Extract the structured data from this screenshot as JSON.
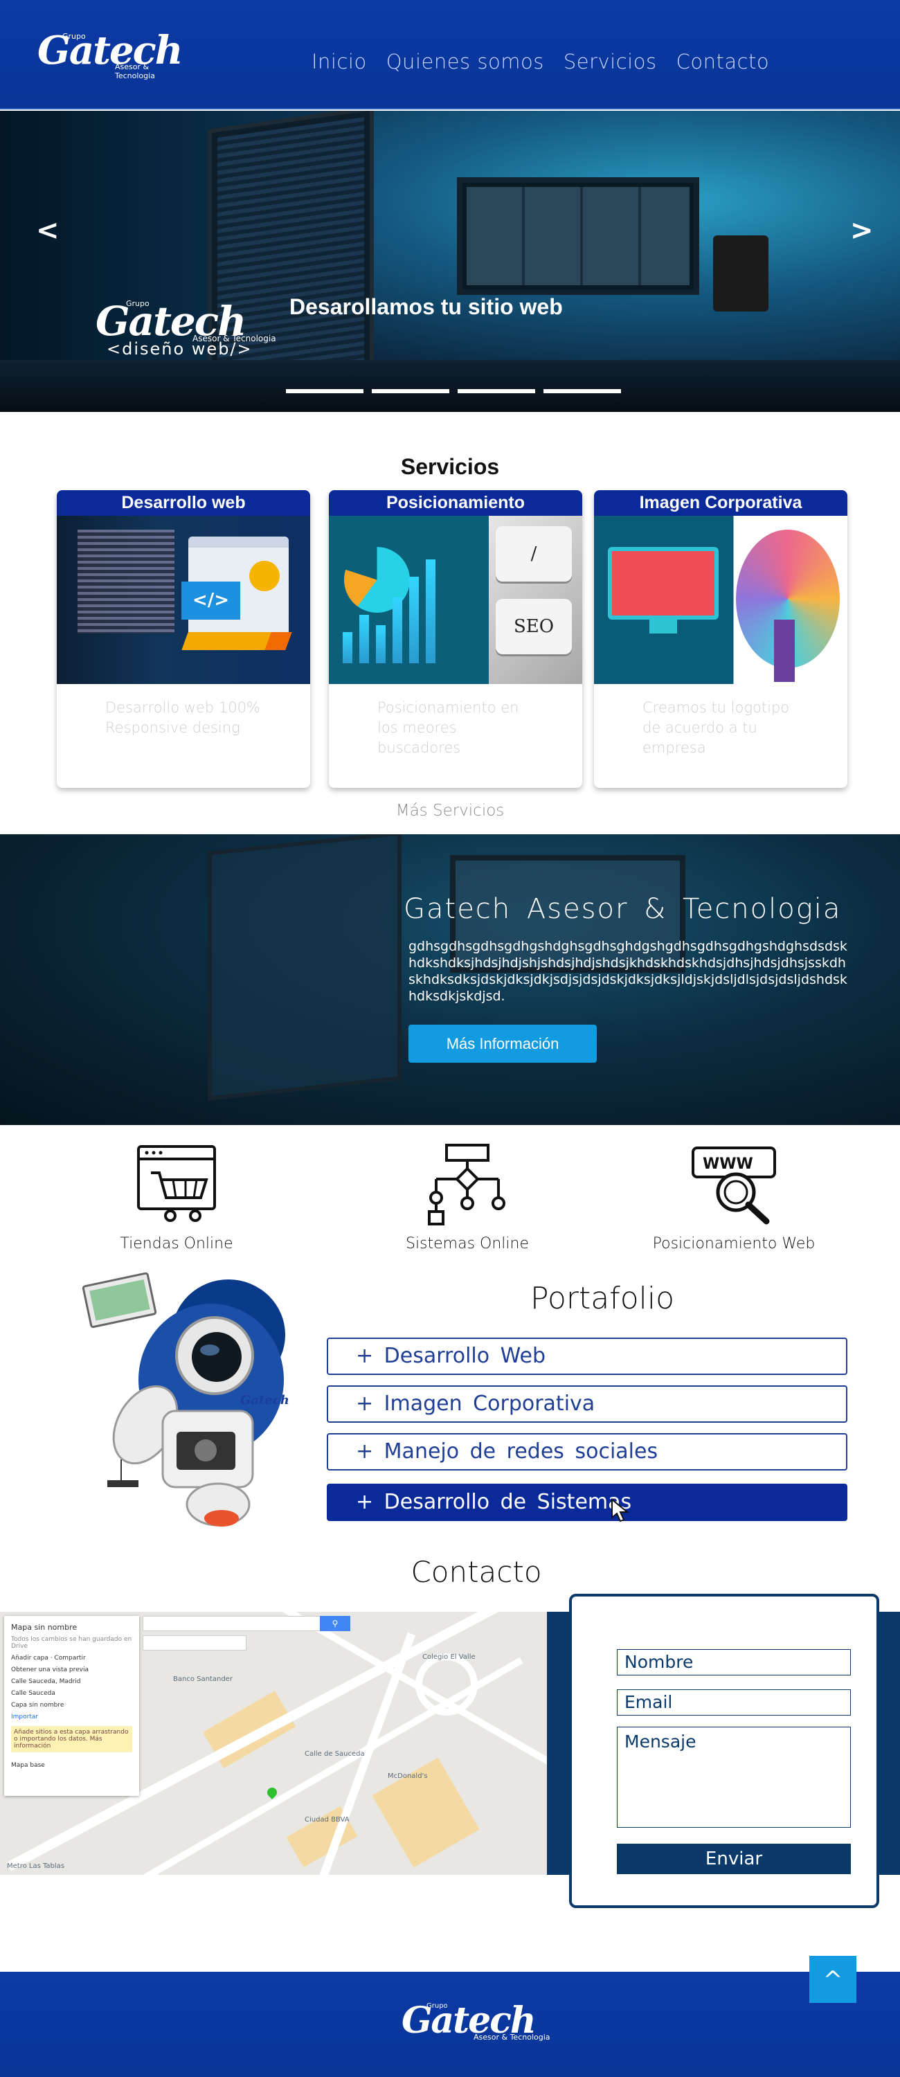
{
  "header": {
    "logo": {
      "small": "Grupo",
      "name": "Gatech",
      "sub": "Asesor & Tecnologia"
    },
    "nav": [
      "Inicio",
      "Quienes somos",
      "Servicios",
      "Contacto"
    ]
  },
  "hero": {
    "prev": "<",
    "next": ">",
    "logo": {
      "small": "Grupo",
      "name": "Gatech",
      "sub": "Asesor & Tecnologia"
    },
    "tagline": "<diseño web/>",
    "headline": "Desarollamos tu sitio web"
  },
  "servicios": {
    "title": "Servicios",
    "cards": [
      {
        "title": "Desarrollo web",
        "text": "Desarrollo web 100% Responsive desing"
      },
      {
        "title": "Posicionamiento",
        "text": "Posicionamiento en los meores buscadores",
        "seo_label": "SEO"
      },
      {
        "title": "Imagen Corporativa",
        "text": "Creamos tu logotipo de acuerdo a tu empresa"
      }
    ],
    "more": "Más Servicios"
  },
  "banner": {
    "title": "Gatech Asesor & Tecnologia",
    "text": "gdhsgdhsgdhsgdhgshdghsgdhsghdgshgdhsgdhsgdhgshdghsdsdskhdkshdksjhdsjhdjshjshdsjhdjshdsjkhdskhdskhdsjdhsjhdsjdhsjsskdhskhdksdksjdskjdksjdkjsdjsjdsjdskjdksjdksjldjskjdsljdlsjdsjdsljdshdskhdksdkjskdjsd.",
    "button": "Más Información"
  },
  "features": [
    "Tiendas Online",
    "Sistemas Online",
    "Posicionamiento Web"
  ],
  "portafolio": {
    "title": "Portafolio",
    "items": [
      "+ Desarrollo Web",
      "+ Imagen Corporativa",
      "+ Manejo de redes sociales",
      "+ Desarrollo de Sistemas"
    ],
    "active_index": 3
  },
  "contacto": {
    "title": "Contacto",
    "map": {
      "panel_title": "Mapa sin nombre",
      "panel_sub": "Todos los cambios se han guardado en Drive",
      "rows": [
        "Añadir capa · Compartir",
        "Obtener una vista previa",
        "Calle Sauceda, Madrid",
        "Calle Sauceda",
        "Capa sin nombre",
        "Importar"
      ],
      "note": "Añade sitios a esta capa arrastrando o importando los datos. Más información",
      "base": "Mapa base",
      "labels": [
        "Banco Santander",
        "Colegio El Valle",
        "Ciudad BBVA",
        "McDonald's",
        "Metro Las Tablas",
        "Calle de Sauceda"
      ]
    },
    "form": {
      "name": "Nombre",
      "email": "Email",
      "message": "Mensaje",
      "submit": "Enviar"
    }
  },
  "to_top": "^",
  "footer": {
    "logo": {
      "small": "Grupo",
      "name": "Gatech",
      "sub": "Asesor & Tecnologia"
    }
  }
}
